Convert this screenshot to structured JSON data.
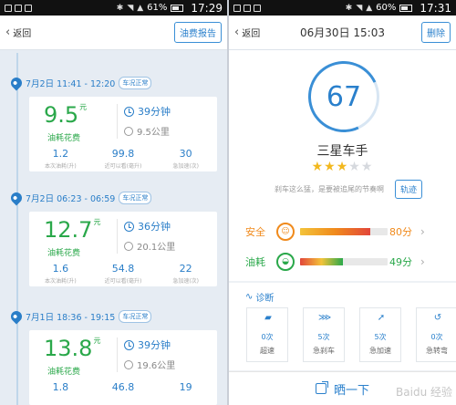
{
  "left": {
    "status": {
      "battery": "61%",
      "time": "17:29"
    },
    "header": {
      "back_label": "返回",
      "report_button": "油费报告"
    },
    "trips": [
      {
        "time": "7月2日 11:41 - 12:20",
        "condition": "车况正常",
        "fee": "9.5",
        "fee_unit": "元",
        "fee_label": "油耗花费",
        "duration": "39分钟",
        "distance": "9.5公里",
        "stats": [
          {
            "value": "1.2",
            "label": "本次油耗(升)"
          },
          {
            "value": "99.8",
            "label": "近可以看(毫升)"
          },
          {
            "value": "30",
            "label": "急加速(次)"
          }
        ]
      },
      {
        "time": "7月2日 06:23 - 06:59",
        "condition": "车况正常",
        "fee": "12.7",
        "fee_unit": "元",
        "fee_label": "油耗花费",
        "duration": "36分钟",
        "distance": "20.1公里",
        "stats": [
          {
            "value": "1.6",
            "label": "本次油耗(升)"
          },
          {
            "value": "54.8",
            "label": "近可以看(毫升)"
          },
          {
            "value": "22",
            "label": "急加速(次)"
          }
        ]
      },
      {
        "time": "7月1日 18:36 - 19:15",
        "condition": "车况正常",
        "fee": "13.8",
        "fee_unit": "元",
        "fee_label": "油耗花费",
        "duration": "39分钟",
        "distance": "19.6公里",
        "stats": [
          {
            "value": "1.8",
            "label": ""
          },
          {
            "value": "46.8",
            "label": ""
          },
          {
            "value": "19",
            "label": ""
          }
        ]
      }
    ]
  },
  "right": {
    "status": {
      "battery": "60%",
      "time": "17:31"
    },
    "header": {
      "back_label": "返回",
      "title": "06月30日 15:03",
      "delete_button": "删除"
    },
    "score": "67",
    "rank": "三星车手",
    "stars": {
      "filled": 3,
      "total": 5
    },
    "hint": "刹车这么猛，是要被追尾的节奏啊",
    "track_button": "轨迹",
    "metrics": [
      {
        "label": "安全",
        "value": "80分",
        "fraction": 0.8,
        "color": "#f08a1c",
        "icon": "shield-person-icon"
      },
      {
        "label": "油耗",
        "value": "49分",
        "fraction": 0.49,
        "color": "#2aa84a",
        "icon": "fuel-drop-icon"
      }
    ],
    "diagnosis_title": "诊断",
    "diagnosis": [
      {
        "count": "0次",
        "label": "超速",
        "icon": "speed-camera-icon"
      },
      {
        "count": "5次",
        "label": "急刹车",
        "icon": "brake-icon"
      },
      {
        "count": "5次",
        "label": "急加速",
        "icon": "accelerate-icon"
      },
      {
        "count": "0次",
        "label": "急转弯",
        "icon": "sharp-turn-icon"
      }
    ],
    "share_label": "晒一下"
  },
  "watermark": "Baidu 经验"
}
